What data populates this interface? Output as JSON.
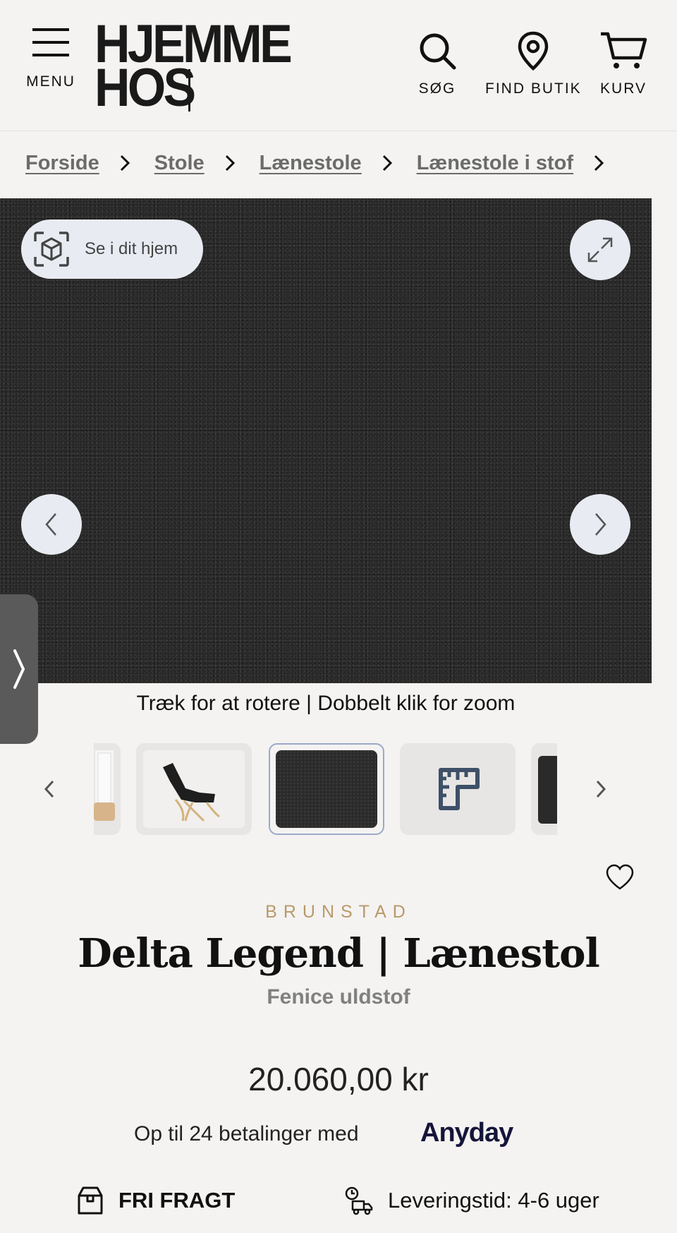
{
  "header": {
    "menu_label": "MENU",
    "logo_line1": "HJEMME",
    "logo_line2": "HOS",
    "search_label": "SØG",
    "find_store_label": "FIND BUTIK",
    "cart_label": "KURV"
  },
  "breadcrumb": {
    "items": [
      "Forside",
      "Stole",
      "Lænestole",
      "Lænestole i stof"
    ]
  },
  "gallery": {
    "ar_label": "Se i dit hjem",
    "hint": "Træk for at rotere | Dobbelt klik for zoom"
  },
  "product": {
    "brand": "BRUNSTAD",
    "title": "Delta Legend | Lænestol",
    "subtitle": "Fenice uldstof",
    "price": "20.060,00 kr",
    "installments_text": "Op til 24 betalinger med",
    "payment_provider": "Anyday",
    "shipping": "FRI FRAGT",
    "delivery": "Leveringstid: 4-6 uger"
  },
  "colors": {
    "brand_gold": "#b8996a",
    "active_thumb_border": "#9aa9c8",
    "button_bg": "#e9ebf2"
  }
}
